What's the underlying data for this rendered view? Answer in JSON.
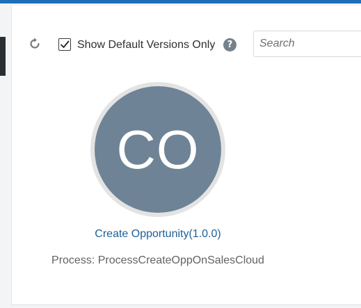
{
  "toolbar": {
    "refresh_icon": "refresh-icon",
    "show_default_checked": true,
    "show_default_label": "Show Default Versions Only",
    "help_glyph": "?",
    "search_placeholder": "Search"
  },
  "card": {
    "initials": "CO",
    "title": "Create Opportunity(1.0.0)",
    "process_line": "Process: ProcessCreateOppOnSalesCloud"
  },
  "colors": {
    "accent": "#1f6fb8",
    "avatar_bg": "#6e8396",
    "link": "#1d5f97"
  }
}
